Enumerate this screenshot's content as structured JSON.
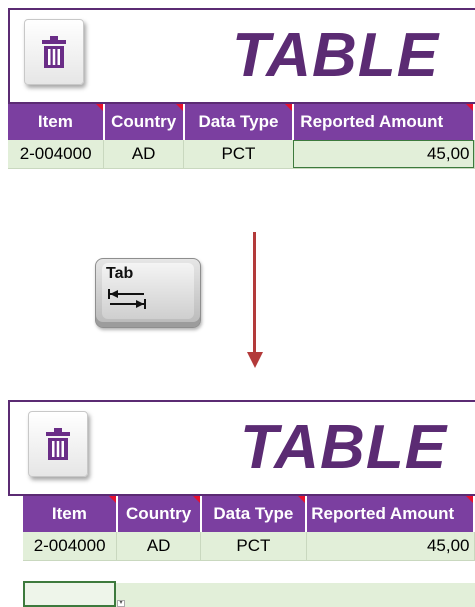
{
  "before": {
    "title": "TABLE",
    "headers": [
      "Item",
      "Country",
      "Data Type",
      "Reported Amount"
    ],
    "row": [
      "2-004000",
      "AD",
      "PCT",
      "45,00"
    ]
  },
  "after": {
    "title": "TABLE",
    "headers": [
      "Item",
      "Country",
      "Data Type",
      "Reported Amount"
    ],
    "row": [
      "2-004000",
      "AD",
      "PCT",
      "45,00"
    ]
  },
  "key": {
    "label": "Tab",
    "icon": "tab-arrows-icon"
  },
  "icons": {
    "delete": "trash-icon"
  },
  "colors": {
    "header": "#7b3fa0",
    "title": "#5b2b73",
    "row": "#e2efd9",
    "arrow": "#b33a3a",
    "flag": "#e8102e"
  }
}
